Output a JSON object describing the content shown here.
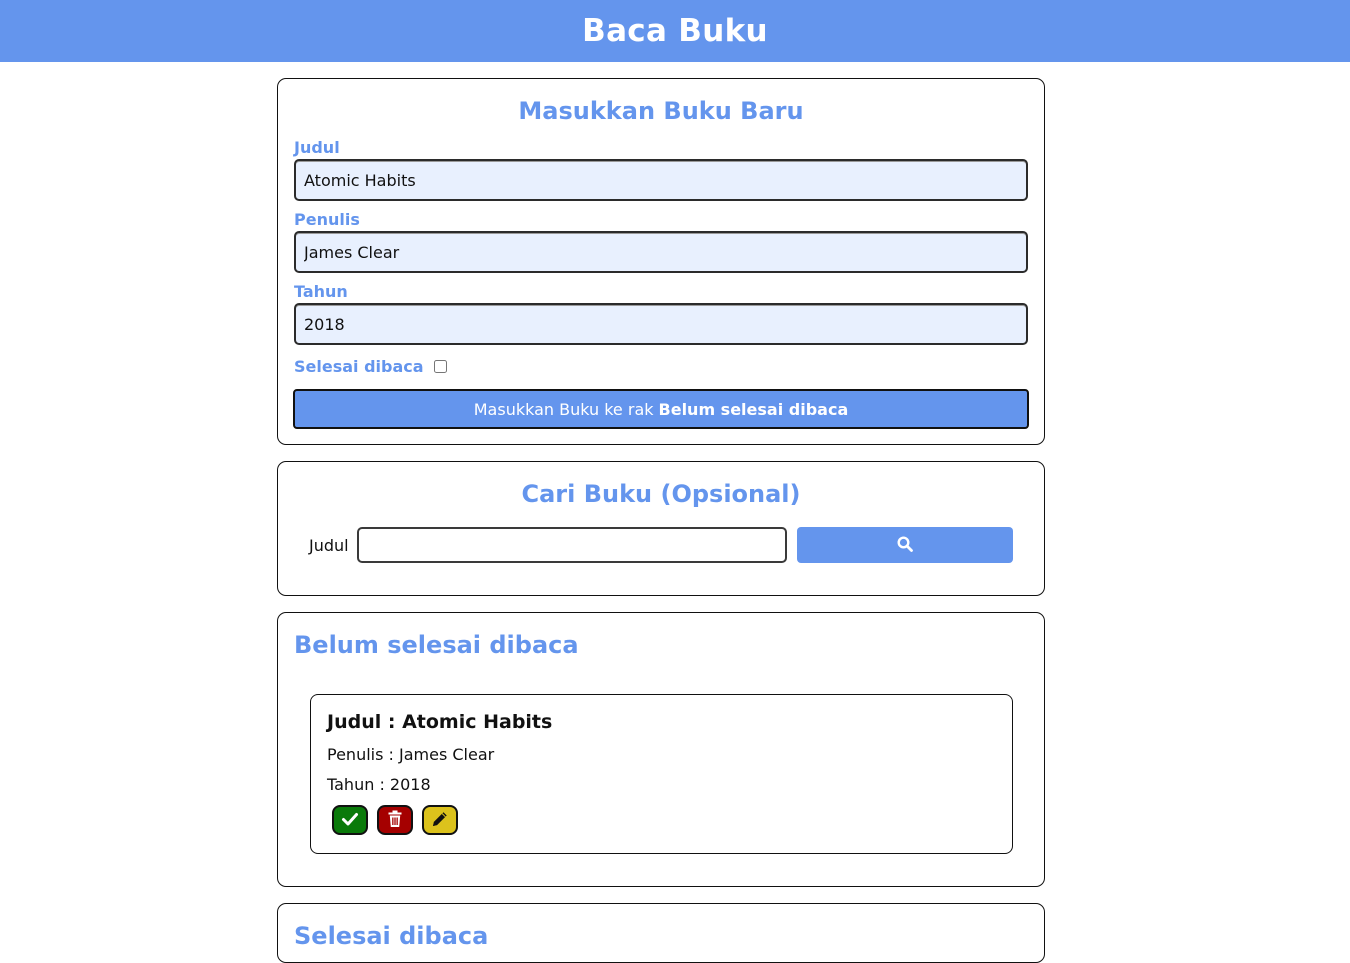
{
  "header": {
    "title": "Baca Buku"
  },
  "input_form": {
    "heading": "Masukkan Buku Baru",
    "title_label": "Judul",
    "title_value": "Atomic Habits",
    "author_label": "Penulis",
    "author_value": "James Clear",
    "year_label": "Tahun",
    "year_value": "2018",
    "complete_label": "Selesai dibaca",
    "complete_checked": false,
    "submit_prefix": "Masukkan Buku ke rak",
    "submit_shelf": "Belum selesai dibaca"
  },
  "search": {
    "heading": "Cari Buku (Opsional)",
    "label": "Judul",
    "value": "",
    "button_icon": "search-icon"
  },
  "unread_shelf": {
    "heading": "Belum selesai dibaca",
    "books": [
      {
        "title": "Judul : Atomic Habits",
        "author": "Penulis : James Clear",
        "year": "Tahun : 2018",
        "actions": [
          "check-icon",
          "trash-icon",
          "pencil-icon"
        ]
      }
    ]
  },
  "done_shelf": {
    "heading": "Selesai dibaca"
  },
  "colors": {
    "accent": "#6495ed",
    "field_bg": "#e8f0fe",
    "done_button": "#0a7a0a",
    "delete_button": "#a50000",
    "edit_button": "#dcc21c"
  }
}
